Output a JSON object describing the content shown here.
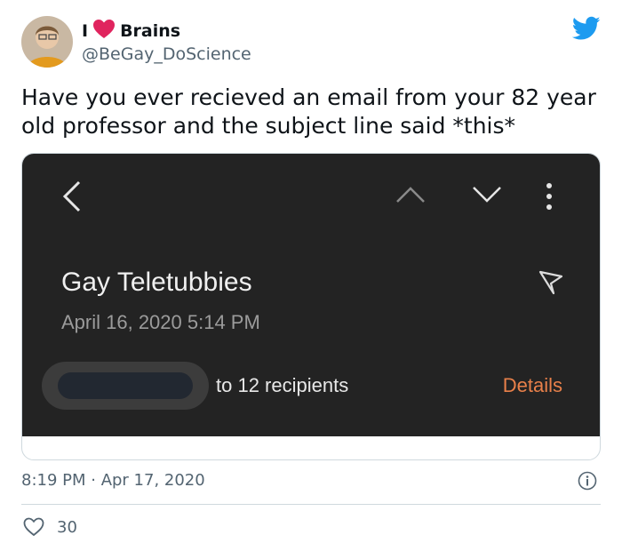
{
  "author": {
    "name_prefix": "I",
    "name_suffix": "Brains",
    "handle": "@BeGay_DoScience"
  },
  "tweet": {
    "text": "Have you ever recieved an email from your 82 year old professor and the subject line said *this*",
    "timestamp": "8:19 PM · Apr 17, 2020",
    "like_count": "30"
  },
  "email": {
    "subject": "Gay Teletubbies",
    "date": "April 16, 2020  5:14 PM",
    "recipients": "to 12 recipients",
    "details_label": "Details"
  },
  "icons": [
    "back-arrow-icon",
    "chevron-up-icon",
    "chevron-down-icon",
    "more-vertical-icon",
    "flag-icon",
    "twitter-bird-icon",
    "heart-icon",
    "info-icon"
  ],
  "colors": {
    "heart": "#e0245e",
    "twitter_blue": "#1d9bf0",
    "email_bg": "#232323",
    "details_orange": "#e8804a"
  }
}
